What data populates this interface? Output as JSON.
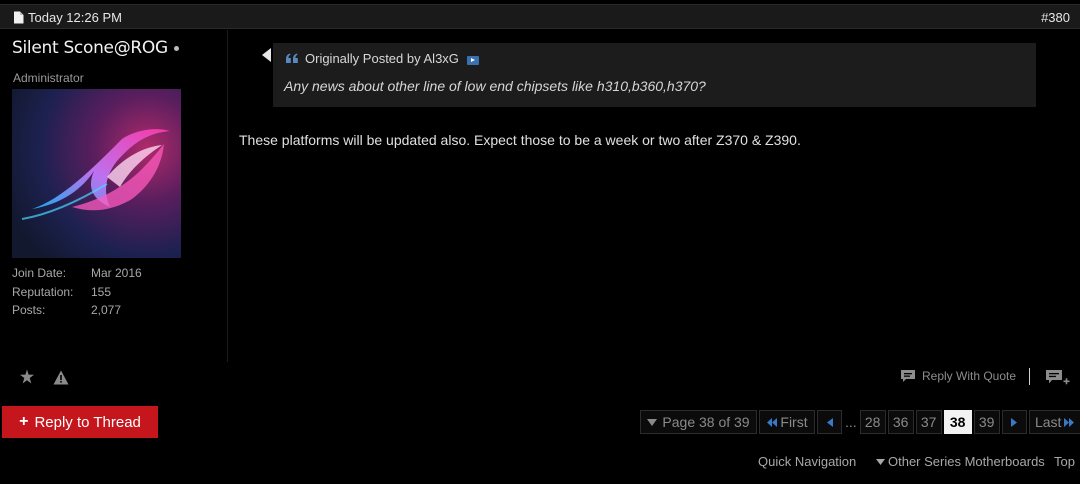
{
  "post": {
    "date": "Today 12:26 PM",
    "number": "#380",
    "author": {
      "name": "Silent Scone@ROG",
      "title": "Administrator",
      "info": [
        {
          "label": "Join Date:",
          "value": "Mar 2016"
        },
        {
          "label": "Reputation:",
          "value": "155"
        },
        {
          "label": "Posts:",
          "value": "2,077"
        }
      ]
    },
    "quote": {
      "header": "Originally Posted by Al3xG",
      "text": "Any news about other line of low end chipsets like h310,b360,h370?"
    },
    "body": "These platforms will be updated also. Expect those to be a week or two after Z370 & Z390.",
    "reply_with_quote": "Reply With Quote"
  },
  "reply_thread": {
    "plus": "+",
    "label": "Reply to Thread"
  },
  "pagination": {
    "page_info": "Page 38 of 39",
    "first": "First",
    "ellipsis": "...",
    "pages": [
      "28",
      "36",
      "37",
      "38",
      "39"
    ],
    "current": "38",
    "last": "Last"
  },
  "bottom_nav": {
    "quick_navigation": "Quick Navigation",
    "forum": "Other Series Motherboards",
    "top": "Top"
  },
  "colors": {
    "accent_red": "#c4161c",
    "link_blue": "#3a78c8"
  }
}
